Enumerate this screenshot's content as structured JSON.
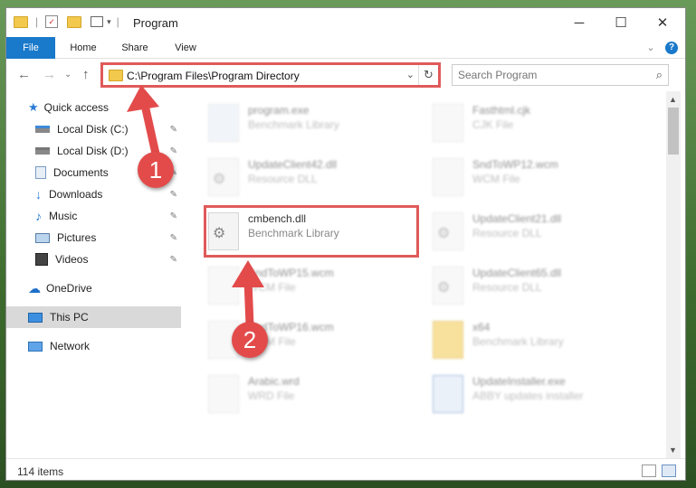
{
  "window": {
    "title": "Program",
    "minimize": "─",
    "maximize": "☐",
    "close": "✕"
  },
  "ribbon": {
    "tabs": [
      "File",
      "Home",
      "Share",
      "View"
    ],
    "expand": "⌄",
    "help": "?"
  },
  "address": {
    "path": "C:\\Program Files\\Program Directory",
    "dropdown": "⌄",
    "refresh": "↻"
  },
  "search": {
    "placeholder": "Search Program",
    "icon": "search-icon"
  },
  "nav": {
    "back": "←",
    "forward": "→",
    "recent": "⌄",
    "up": "↑"
  },
  "sidebar": {
    "items": [
      {
        "label": "Quick access",
        "icon": "star-icon",
        "pinned": false
      },
      {
        "label": "Local Disk (C:)",
        "icon": "drive-icon",
        "pinned": true
      },
      {
        "label": "Local Disk (D:)",
        "icon": "drive-icon",
        "pinned": true
      },
      {
        "label": "Documents",
        "icon": "documents-icon",
        "pinned": true
      },
      {
        "label": "Downloads",
        "icon": "download-icon",
        "pinned": true
      },
      {
        "label": "Music",
        "icon": "music-icon",
        "pinned": true
      },
      {
        "label": "Pictures",
        "icon": "pictures-icon",
        "pinned": true
      },
      {
        "label": "Videos",
        "icon": "videos-icon",
        "pinned": true
      },
      {
        "label": "OneDrive",
        "icon": "cloud-icon",
        "pinned": false
      },
      {
        "label": "This PC",
        "icon": "computer-icon",
        "pinned": false
      },
      {
        "label": "Network",
        "icon": "network-icon",
        "pinned": false
      }
    ],
    "pin_glyph": "📌"
  },
  "files": [
    {
      "name": "program.exe",
      "type": "Benchmark Library"
    },
    {
      "name": "Fasthtml.cjk",
      "type": "CJK File"
    },
    {
      "name": "UpdateClient42.dll",
      "type": "Resource DLL"
    },
    {
      "name": "SndToWP12.wcm",
      "type": "WCM File"
    },
    {
      "name": "cmbench.dll",
      "type": "Benchmark Library"
    },
    {
      "name": "UpdateClient21.dll",
      "type": "Resource DLL"
    },
    {
      "name": "SndToWP15.wcm",
      "type": "WCM File"
    },
    {
      "name": "UpdateClient65.dll",
      "type": "Resource DLL"
    },
    {
      "name": "SndToWP16.wcm",
      "type": "WCM File"
    },
    {
      "name": "x64",
      "type": "Benchmark Library"
    },
    {
      "name": "Arabic.wrd",
      "type": "WRD File"
    },
    {
      "name": "UpdateInstaller.exe",
      "type": "ABBY updates installer"
    }
  ],
  "status": {
    "item_count": "114 items"
  },
  "callouts": [
    "1",
    "2"
  ],
  "colors": {
    "accent": "#1979ca",
    "highlight": "#e05a5a",
    "callout": "#e34b4b"
  }
}
